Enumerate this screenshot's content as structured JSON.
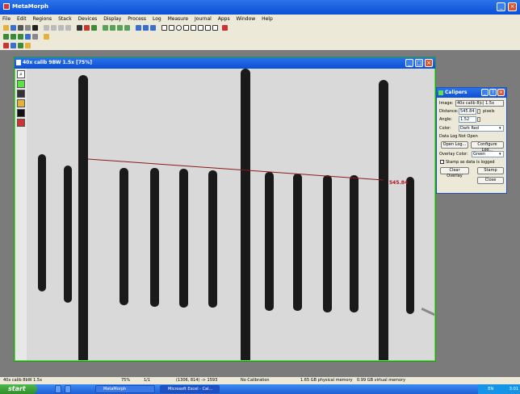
{
  "app": {
    "title": "MetaMorph",
    "menus": [
      "File",
      "Edit",
      "Regions",
      "Stack",
      "Devices",
      "Display",
      "Process",
      "Log",
      "Measure",
      "Journal",
      "Apps",
      "Window",
      "Help"
    ]
  },
  "image_window": {
    "title": "40x calib 9BW 1.5x [75%]",
    "measurement_label": "545.84"
  },
  "calipers": {
    "title": "Calipers",
    "image_label": "Image:",
    "image_value": "40x calib 8|c| 1.5x",
    "distance_label": "Distance:",
    "distance_value": "545.84",
    "distance_unit": "pixels",
    "angle_label": "Angle:",
    "angle_value": "1.52",
    "color_label": "Color:",
    "color_value": "Dark Red",
    "data_log_status": "Data Log Not Open",
    "open_log": "Open Log...",
    "configure_log": "Configure Log...",
    "overlay_color_label": "Overlay Color:",
    "overlay_color_value": "Green",
    "stamp_checkbox": "Stamp as data is logged",
    "clear_overlay": "Clear Overlay",
    "stamp": "Stamp",
    "close": "Close"
  },
  "status": {
    "image_name": "40x calib 8bW 1.5x",
    "zoom": "75%",
    "plane": "1/1",
    "coords": "(1306, 814) -> 1593",
    "calibration": "No Calibration",
    "physical_memory": "1.65 GB physical memory",
    "virtual_memory": "0.99 GB virtual memory"
  },
  "taskbar": {
    "start": "start",
    "items": [
      "MetaMorph",
      "Microsoft Excel - Cal..."
    ],
    "tray_lang": "EN",
    "clock": "3:01"
  },
  "colors": {
    "title_blue": "#0b4fd8",
    "window_border_green": "#5fe048",
    "measurement_line": "#8b1a1a"
  }
}
